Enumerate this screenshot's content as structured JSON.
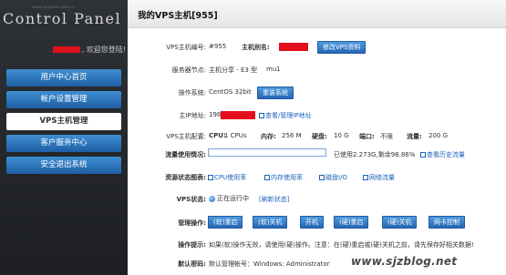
{
  "logo": {
    "small_text": "www.vpsplus.com.cn",
    "title": "Control Panel"
  },
  "sidebar": {
    "welcome": ", 欢迎您登陆!",
    "items": [
      {
        "label": "用户中心首页"
      },
      {
        "label": "帐户设置管理"
      },
      {
        "label": "VPS主机管理"
      },
      {
        "label": "客户服务中心"
      },
      {
        "label": "安全退出系统"
      }
    ]
  },
  "header": {
    "title": "我的VPS主机[955]"
  },
  "vps": {
    "id_label": "VPS主机编号:",
    "id_value": "#955",
    "alias_label": "主机别名:",
    "modify_button": "修改VPS资料",
    "node_label": "服务器节点:",
    "node_value": "主机分享 - E3 型",
    "node_code": "mu1",
    "os_label": "操作系统:",
    "os_value": "CentOS 32bit",
    "reinstall_button": "重装系统",
    "ip_label": "主IP地址:",
    "ip_value_prefix": "198",
    "ip_link": "查看/管理IP地址",
    "config_label": "VPS主机配置:",
    "cpu_label": "CPU:",
    "cpu_value": "1 CPUs",
    "mem_label": "内存:",
    "mem_value": "256 M",
    "disk_label": "硬盘:",
    "disk_value": "10 G",
    "port_label": "端口:",
    "port_value": "不限",
    "traffic_label": "流量:",
    "traffic_value": "200 G",
    "usage_label": "流量使用情况:",
    "usage_fraction": 0.0114,
    "usage_text": "已使用2.273G,剩余98.86%",
    "usage_link": "查看历史流量",
    "resource_label": "资源状态图表:",
    "resource_links": [
      "CPU使用率",
      "内存使用率",
      "磁盘I/O",
      "网络流量"
    ],
    "status_label": "VPS状态:",
    "status_value": "正在运行中",
    "refresh_link": "[刷新状态]",
    "ops_label": "管理操作:",
    "ops_buttons": [
      "(软)重启",
      "(软)关机",
      "开机",
      "(硬)重启",
      "(硬)关机",
      "网卡控制"
    ],
    "tips_label": "操作提示:",
    "tips_text": "如果(软)操作无效，请使用(硬)操作。注意：在(硬)重启或(硬)关机之前，请先保存好相关数据!",
    "password_label": "默认密码:",
    "password_text": "默认管理帐号：Windows: Administrator",
    "watermark": "www.sjzblog.net"
  }
}
